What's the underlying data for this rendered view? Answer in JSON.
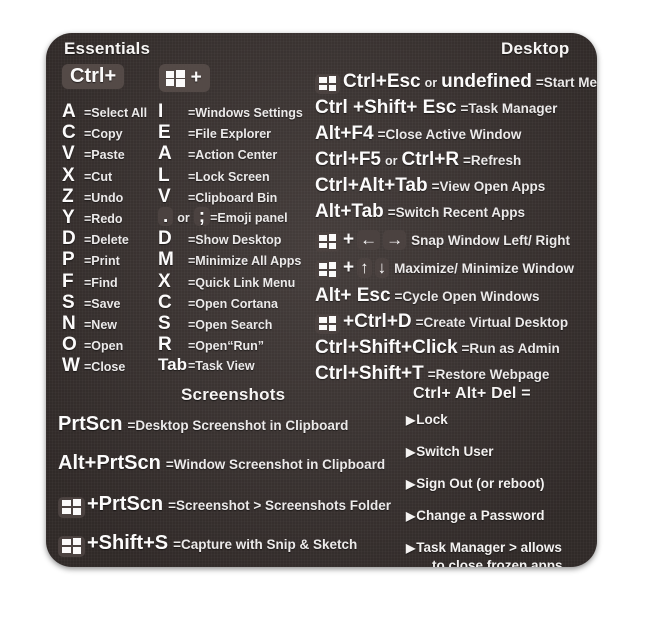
{
  "card": {
    "bg_color": "#3b3331",
    "text_color": "#f2efed"
  },
  "sections": {
    "essentials": {
      "title": "Essentials"
    },
    "desktop": {
      "title": "Desktop"
    },
    "screenshots": {
      "title": "Screenshots"
    },
    "ctrl_alt_del": {
      "title": "Ctrl+ Alt+ Del ="
    }
  },
  "ctrl_column": {
    "header": "Ctrl+",
    "items": [
      {
        "key": "A",
        "eq": "=",
        "desc": "Select All"
      },
      {
        "key": "C",
        "eq": "=",
        "desc": "Copy"
      },
      {
        "key": "V",
        "eq": "=",
        "desc": "Paste"
      },
      {
        "key": "X",
        "eq": "=",
        "desc": "Cut"
      },
      {
        "key": "Z",
        "eq": "=",
        "desc": "Undo"
      },
      {
        "key": "Y",
        "eq": "=",
        "desc": "Redo"
      },
      {
        "key": "D",
        "eq": "=",
        "desc": "Delete"
      },
      {
        "key": "P",
        "eq": "=",
        "desc": "Print"
      },
      {
        "key": "F",
        "eq": "=",
        "desc": "Find"
      },
      {
        "key": "S",
        "eq": "=",
        "desc": "Save"
      },
      {
        "key": "N",
        "eq": "=",
        "desc": "New"
      },
      {
        "key": "O",
        "eq": "=",
        "desc": "Open"
      },
      {
        "key": "W",
        "eq": "=",
        "desc": "Close"
      }
    ]
  },
  "win_column": {
    "header_icon": "windows-logo-icon",
    "header_plus": "+",
    "items": [
      {
        "key": "I",
        "eq": "=",
        "desc": "Windows Settings"
      },
      {
        "key": "E",
        "eq": "=",
        "desc": "File Explorer"
      },
      {
        "key": "A",
        "eq": "=",
        "desc": "Action Center"
      },
      {
        "key": "L",
        "eq": "=",
        "desc": "Lock Screen"
      },
      {
        "key": "V",
        "eq": "=",
        "desc": "Clipboard Bin"
      },
      {
        "key": ".",
        "or": "or",
        "key2": ";",
        "eq": "=",
        "desc": "Emoji panel"
      },
      {
        "key": "D",
        "eq": "=",
        "desc": "Show Desktop"
      },
      {
        "key": "M",
        "eq": "=",
        "desc": "Minimize All Apps"
      },
      {
        "key": "X",
        "eq": "=",
        "desc": "Quick Link Menu"
      },
      {
        "key": "C",
        "eq": "=",
        "desc": "Open Cortana"
      },
      {
        "key": "S",
        "eq": "=",
        "desc": "Open Search"
      },
      {
        "key": "R",
        "eq": "=",
        "desc": "Open“Run”"
      },
      {
        "key": "Tab",
        "eq": "=",
        "desc": "Task View"
      }
    ]
  },
  "desktop_column": {
    "rows": [
      {
        "pre_icon": "windows-logo-icon",
        "or": "or",
        "keys": "Ctrl+Esc",
        "eq": "=",
        "desc": "Start Menu"
      },
      {
        "keys": "Ctrl +Shift+ Esc",
        "eq": "=",
        "desc": "Task Manager"
      },
      {
        "keys": "Alt+F4",
        "eq": "=",
        "desc": "Close Active Window"
      },
      {
        "keys": "Ctrl+F5",
        "or": "or",
        "keys2": "Ctrl+R",
        "eq": "=",
        "desc": "Refresh"
      },
      {
        "keys": "Ctrl+Alt+Tab",
        "eq": "=",
        "desc": "View Open Apps"
      },
      {
        "keys": "Alt+Tab",
        "eq": "=",
        "desc": "Switch Recent Apps"
      },
      {
        "pre_icon": "windows-logo-icon",
        "plus": "+",
        "arrow1": "←",
        "arrow2": "→",
        "desc": "Snap Window Left/ Right"
      },
      {
        "pre_icon": "windows-logo-icon",
        "plus": "+",
        "arrow1": "↑",
        "arrow2": "↓",
        "desc": "Maximize/ Minimize Window"
      },
      {
        "keys": "Alt+ Esc",
        "eq": "=",
        "desc": "Cycle Open Windows"
      },
      {
        "pre_icon": "windows-logo-icon",
        "keys": "+Ctrl+D",
        "eq": "=",
        "desc": "Create Virtual Desktop"
      },
      {
        "keys": "Ctrl+Shift+Click",
        "eq": "=",
        "desc": "Run as Admin"
      },
      {
        "keys": "Ctrl+Shift+T",
        "eq": "=",
        "desc": "Restore Webpage"
      }
    ]
  },
  "screenshots_rows": [
    {
      "keys": "PrtScn",
      "eq": "=",
      "desc": "Desktop Screenshot in Clipboard"
    },
    {
      "keys": "Alt+PrtScn",
      "eq": "=",
      "desc": "Window Screenshot in Clipboard"
    },
    {
      "pre_icon": "windows-logo-icon",
      "keys": "+PrtScn",
      "eq": "=",
      "desc": "Screenshot > Screenshots Folder"
    },
    {
      "pre_icon": "windows-logo-icon",
      "keys": "+Shift+S",
      "eq": "=",
      "desc": "Capture with Snip & Sketch"
    }
  ],
  "cad_items": [
    {
      "marker": "▶",
      "label": "Lock"
    },
    {
      "marker": "▶",
      "label": "Switch User"
    },
    {
      "marker": "▶",
      "label": "Sign Out (or reboot)"
    },
    {
      "marker": "▶",
      "label": "Change a Password"
    },
    {
      "marker": "▶",
      "label": "Task Manager > allows",
      "label2": "to close frozen apps"
    }
  ]
}
